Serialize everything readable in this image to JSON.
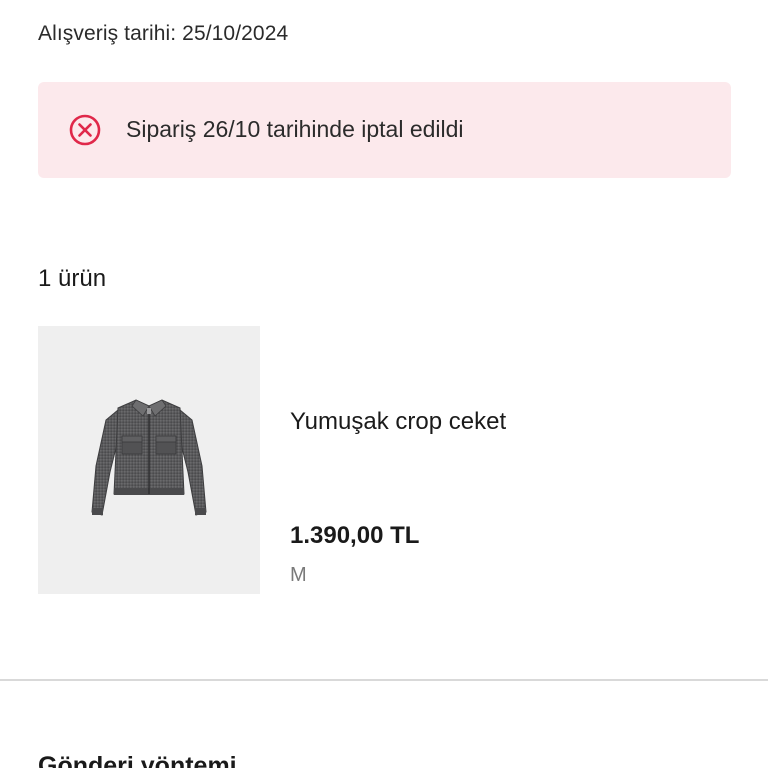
{
  "order": {
    "purchase_date": "Alışveriş tarihi: 25/10/2024",
    "cancel_message": "Sipariş 26/10 tarihinde iptal edildi"
  },
  "products": {
    "count_label": "1 ürün",
    "items": [
      {
        "name": "Yumuşak crop ceket",
        "price": "1.390,00 TL",
        "size": "M",
        "image_icon": "jacket-image"
      }
    ]
  },
  "shipping": {
    "title": "Gönderi yöntemi"
  },
  "colors": {
    "cancel_banner_bg": "#fce9ec",
    "cancel_icon": "#e0284a",
    "text_primary": "#1a1a1a",
    "text_muted": "#7a7a7a"
  },
  "icons": {
    "cancel": "cancel-circle-icon"
  }
}
